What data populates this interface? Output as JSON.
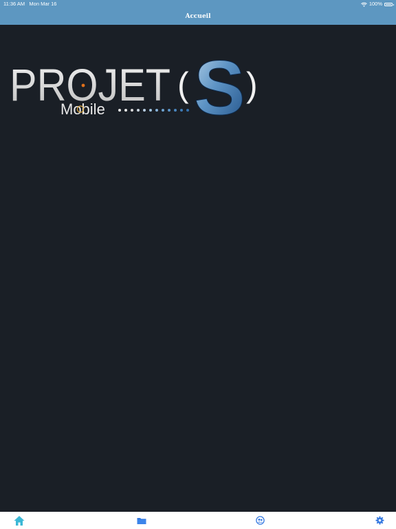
{
  "status_bar": {
    "time": "11:36 AM",
    "date": "Mon Mar 16",
    "battery": "100%",
    "icons": [
      "wifi-icon",
      "battery-icon"
    ]
  },
  "nav_bar": {
    "title": "Accueil"
  },
  "logo": {
    "word": "PROJET",
    "letter": "S",
    "open_paren": "(",
    "close_paren": ")",
    "subtitle": "Mobile",
    "colors": {
      "text": "#e9e9e9",
      "accent_orange": "#e0701b",
      "s_blue": "#2f6ea9",
      "s_light": "#9fc2de"
    }
  },
  "tab_bar": {
    "tabs": [
      {
        "icon": "home-icon",
        "active": true,
        "color": "#3bb8d6"
      },
      {
        "icon": "folder-icon",
        "active": false,
        "color": "#3478e0"
      },
      {
        "icon": "contacts-icon",
        "active": false,
        "color": "#3478e0"
      },
      {
        "icon": "gear-icon",
        "active": false,
        "color": "#3478e0"
      }
    ]
  },
  "colors": {
    "background": "#1a1f26",
    "header": "#5d97c1"
  }
}
